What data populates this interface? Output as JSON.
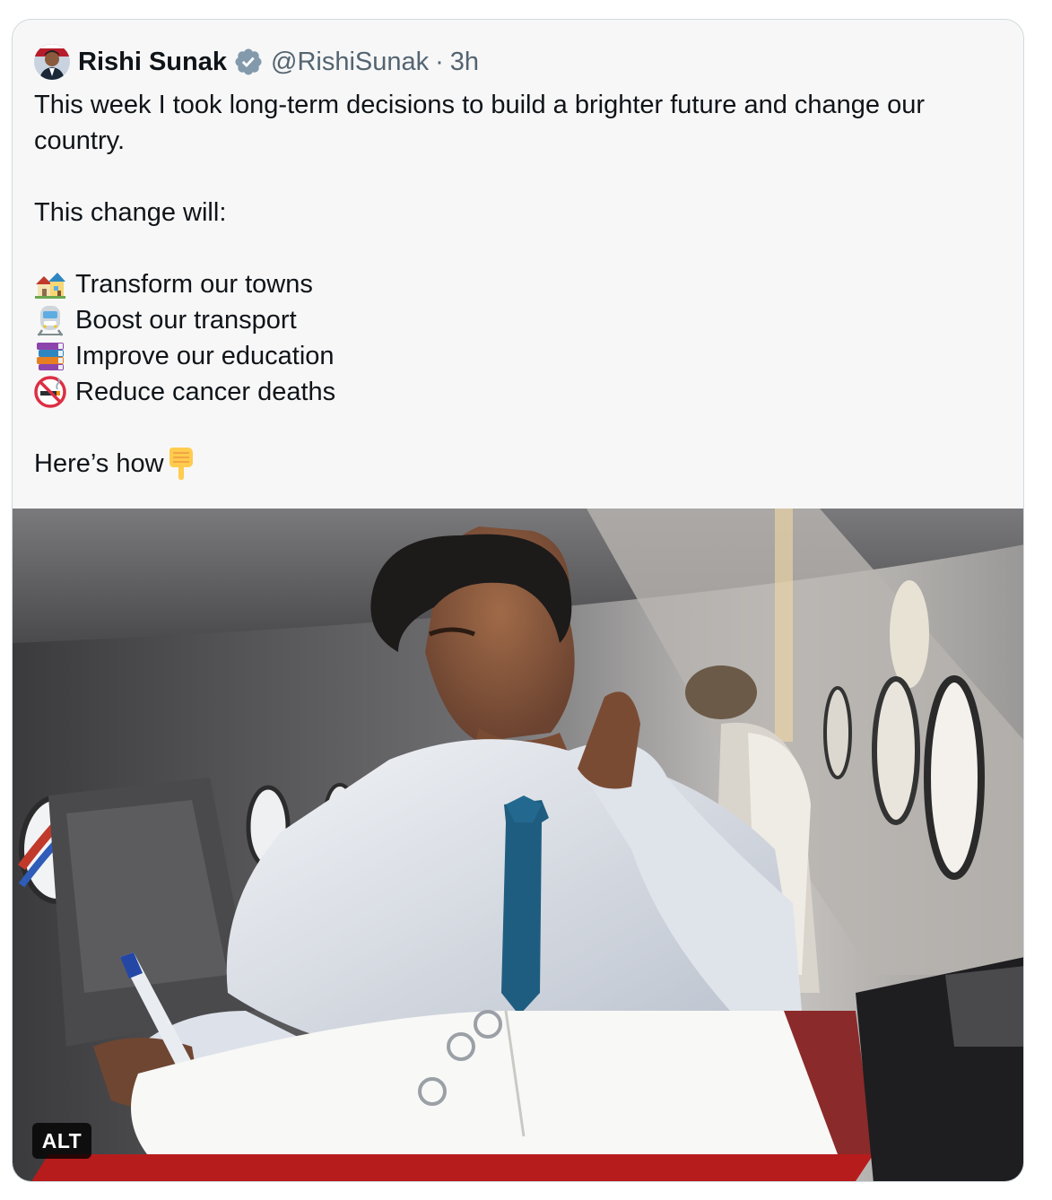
{
  "tweet": {
    "author_name": "Rishi Sunak",
    "handle": "@RishiSunak",
    "separator": "·",
    "timestamp": "3h",
    "intro_line": "This week I took long-term decisions to build a brighter future and change our country.",
    "lead_in": "This change will:",
    "items": [
      {
        "icon": "houses-icon",
        "label": "Transform our towns"
      },
      {
        "icon": "train-icon",
        "label": "Boost our transport"
      },
      {
        "icon": "books-icon",
        "label": "Improve our education"
      },
      {
        "icon": "no-smoking-icon",
        "label": "Reduce cancer deaths"
      }
    ],
    "closing": "Here’s how",
    "closing_icon": "pointing-down-icon"
  },
  "media": {
    "alt_label": "ALT"
  },
  "colors": {
    "verified_badge": "#829aab",
    "primary_text": "#0f1419",
    "secondary_text": "#536471"
  }
}
